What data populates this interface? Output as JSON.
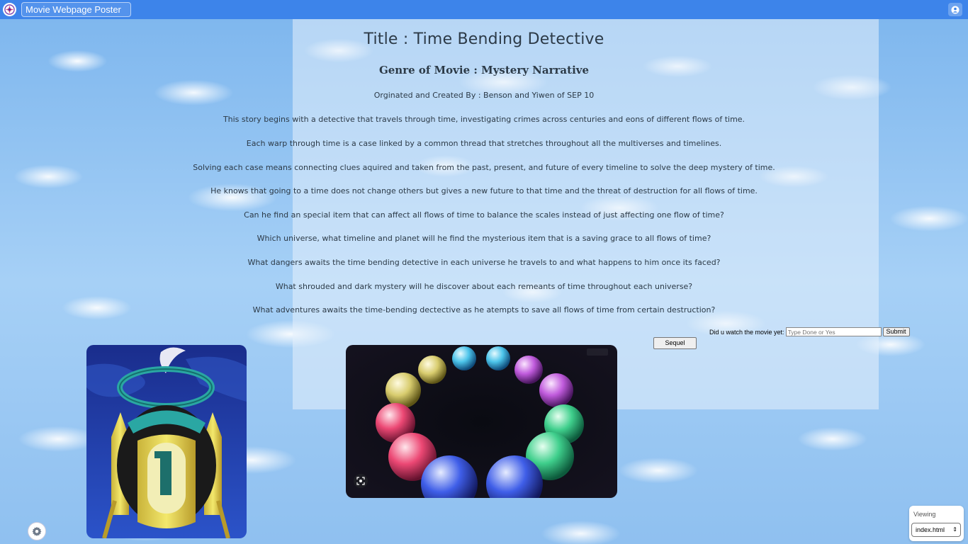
{
  "app": {
    "project_name": "Movie Webpage Poster"
  },
  "poster": {
    "title": "Title : Time Bending Detective",
    "genre": "Genre of Movie : Mystery Narrative",
    "credits": "Orginated and Created By : Benson and Yiwen of SEP 10",
    "lines": [
      "This story begins with a detective that travels through time, investigating crimes across centuries and eons of different flows of time.",
      "Each warp through time is a case linked by a common thread that stretches throughout all the multiverses and timelines.",
      "Solving each case means connecting clues aquired and taken from the past, present, and future of every timeline to solve the deep mystery of time.",
      "He knows that going to a time does not change others but gives a new future to that time and the threat of destruction for all flows of time.",
      "Can he find an special item that can affect all flows of time to balance the scales instead of just affecting one flow of time?",
      "Which universe, what timeline and planet will he find the mysterious item that is a saving grace to all flows of time?",
      "What dangers awaits the time bending detective in each universe he travels to and what happens to him once its faced?",
      "What shrouded and dark mystery will he discover about each remeants of time throughout each universe?",
      "What adventures awaits the time-bending dectective as he atempts to save all flows of time from certain destruction?"
    ]
  },
  "form": {
    "question": "Did u watch the movie yet:",
    "placeholder": "Type Done or Yes",
    "submit_label": "Submit",
    "sequel_label": "Sequel"
  },
  "viewer": {
    "label": "Viewing",
    "file": "index.html"
  },
  "icons": {
    "logo": "app-logo-icon",
    "user": "user-account-icon",
    "settings": "gear-icon",
    "lens": "lens-scan-icon",
    "select": "chevron-updown-icon"
  },
  "colors": {
    "topbar": "#3d84ea",
    "text": "#2c3a47"
  }
}
